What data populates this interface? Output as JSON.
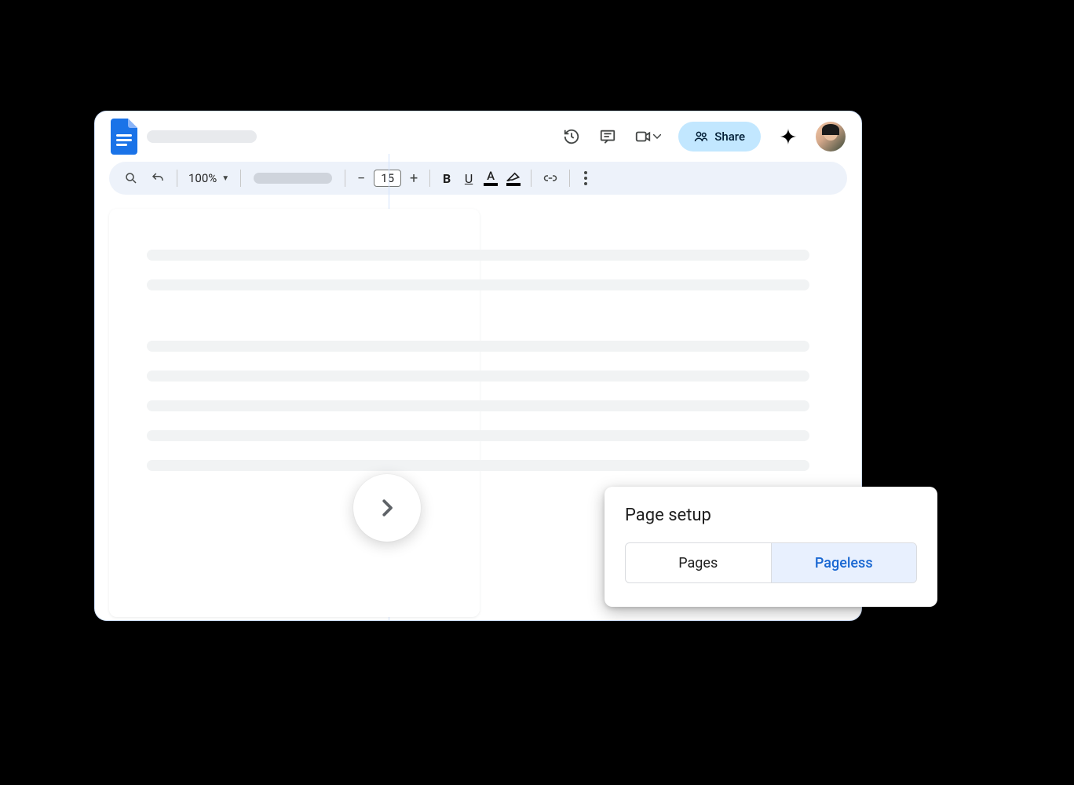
{
  "header": {
    "share_label": "Share"
  },
  "toolbar": {
    "zoom_label": "100%",
    "font_size": "15"
  },
  "page_setup": {
    "title": "Page setup",
    "option_pages": "Pages",
    "option_pageless": "Pageless"
  }
}
